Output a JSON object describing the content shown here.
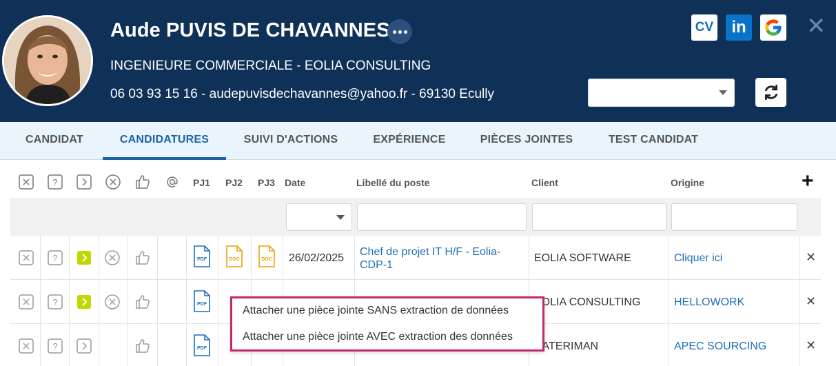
{
  "header": {
    "name": "Aude PUVIS DE CHAVANNES",
    "subtitle": "INGENIEURE COMMERCIALE - EOLIA CONSULTING",
    "contact": "06 03 93 15 16 - audepuvisdechavannes@yahoo.fr - 69130 Ecully",
    "cv_label": "CV",
    "linkedin_label": "in",
    "select_value": "",
    "close_label": "✕"
  },
  "tabs": [
    {
      "label": "CANDIDAT"
    },
    {
      "label": "CANDIDATURES",
      "active": true
    },
    {
      "label": "SUIVI D'ACTIONS"
    },
    {
      "label": "EXPÉRIENCE"
    },
    {
      "label": "PIÈCES JOINTES"
    },
    {
      "label": "TEST CANDIDAT"
    }
  ],
  "table": {
    "columns": {
      "pj1": "PJ1",
      "pj2": "PJ2",
      "pj3": "PJ3",
      "date": "Date",
      "poste": "Libellé du poste",
      "client": "Client",
      "origine": "Origine",
      "add": "+"
    },
    "icons": [
      "close-box-icon",
      "question-box-icon",
      "chevron-box-icon",
      "cancel-circle-icon",
      "thumbs-up-icon",
      "at-icon"
    ],
    "rows": [
      {
        "status_active": true,
        "cancel": true,
        "date": "26/02/2025",
        "poste": "Chef de projet IT H/F - Eolia-CDP-1",
        "client": "EOLIA SOFTWARE",
        "origine": "Cliquer ici",
        "files": [
          "PDF",
          "DOC",
          "DOC"
        ]
      },
      {
        "status_active": true,
        "cancel": true,
        "date": "",
        "poste": "",
        "client": "EOLIA CONSULTING",
        "origine": "HELLOWORK",
        "files": [
          "PDF"
        ]
      },
      {
        "status_active": false,
        "cancel": false,
        "date": "",
        "poste": "",
        "client": "CATERIMAN",
        "origine": "APEC SOURCING",
        "files": [
          "PDF"
        ]
      }
    ]
  },
  "context_menu": {
    "items": [
      "Attacher une pièce jointe SANS extraction de données",
      "Attacher une pièce jointe AVEC extraction des données"
    ]
  },
  "colors": {
    "header_bg": "#0f3158",
    "tabs_bg": "#e9f4fc",
    "accent": "#1d62a8",
    "status_green": "#c3d600",
    "doc_orange": "#e9a20c",
    "pdf_blue": "#1d6fb8",
    "menu_border": "#c2286a"
  }
}
